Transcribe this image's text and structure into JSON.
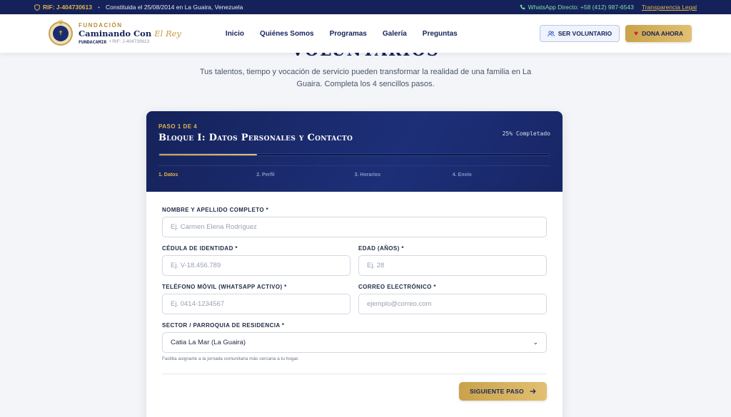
{
  "topbar": {
    "rif": "RIF: J-404730613",
    "constituted": "Constituida el 25/08/2014 en La Guaira, Venezuela",
    "whatsapp": "WhatsApp Directo: +58 (412) 987-6543",
    "transparency": "Transparencia Legal"
  },
  "brand": {
    "fundacion": "FUNDACIÓN",
    "name_main": "Caminando Con ",
    "name_accent": "El Rey",
    "acronym": "FUNDACAMIR",
    "rif_small": "RIF: J-404730613"
  },
  "nav": {
    "items": [
      "Inicio",
      "Quiénes Somos",
      "Programas",
      "Galería",
      "Preguntas"
    ]
  },
  "header_actions": {
    "volunteer": "SER VOLUNTARIO",
    "donate": "DONA AHORA"
  },
  "hero": {
    "title": "VOLUNTARIOS",
    "subtitle": "Tus talentos, tiempo y vocación de servicio pueden transformar la realidad de una familia en La Guaira. Completa los 4 sencillos pasos."
  },
  "wizard": {
    "step_of": "PASO 1 DE 4",
    "block_title": "Bloque I: Datos Personales y Contacto",
    "percent_label": "25% Completado",
    "progress": 0.25,
    "steps": [
      "1. Datos",
      "2. Perfil",
      "3. Horarios",
      "4. Envío"
    ],
    "active_step": 0
  },
  "form": {
    "full_name": {
      "label": "NOMBRE Y APELLIDO COMPLETO *",
      "placeholder": "Ej. Carmen Elena Rodríguez"
    },
    "id_card": {
      "label": "CÉDULA DE IDENTIDAD *",
      "placeholder": "Ej. V-18.456.789"
    },
    "age": {
      "label": "EDAD (AÑOS) *",
      "placeholder": "Ej. 28"
    },
    "phone": {
      "label": "TELÉFONO MÓVIL (WHATSAPP ACTIVO) *",
      "placeholder": "Ej. 0414-1234567"
    },
    "email": {
      "label": "CORREO ELECTRÓNICO *",
      "placeholder": "ejemplo@correo.com"
    },
    "sector": {
      "label": "SECTOR / PARROQUIA DE RESIDENCIA *",
      "value": "Catia La Mar (La Guaira)",
      "hint": "Facilita asignarte a la jornada comunitaria más cercana a tu hogar."
    },
    "next_button": "SIGUIENTE PASO"
  },
  "colors": {
    "navy": "#15225a",
    "gold": "#c9a24a",
    "whatsapp_green": "#7fdca6"
  }
}
